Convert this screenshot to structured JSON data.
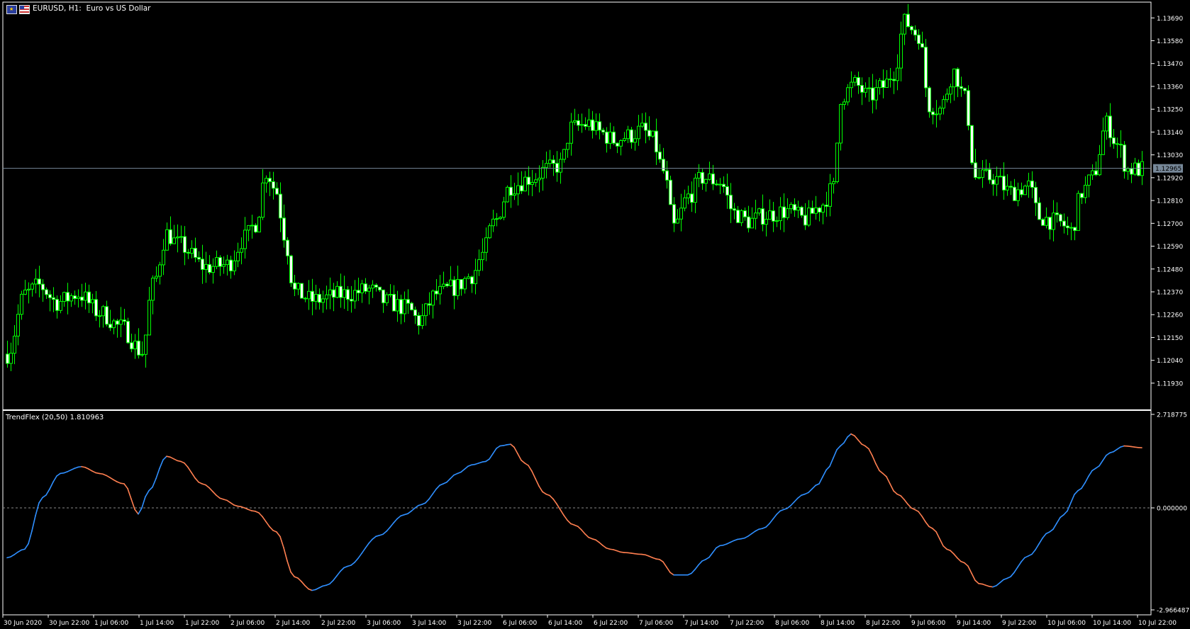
{
  "window": {
    "symbol_title": "EURUSD, H1:  Euro vs US Dollar",
    "current_price_label": "1.12965"
  },
  "price_axis": {
    "labels": [
      "1.13690",
      "1.13580",
      "1.13470",
      "1.13360",
      "1.13250",
      "1.13140",
      "1.13030",
      "1.12920",
      "1.12810",
      "1.12700",
      "1.12590",
      "1.12480",
      "1.12370",
      "1.12260",
      "1.12150",
      "1.12040",
      "1.11930"
    ],
    "max": 1.13708,
    "min": 1.11858
  },
  "indicator": {
    "title": "TrendFlex (20,50) 1.810963",
    "axis_labels": [
      "2.718775",
      "0.000000",
      "-2.966487"
    ],
    "max": 2.718775,
    "min": -2.966487
  },
  "time_axis": {
    "labels": [
      "30 Jun 2020",
      "30 Jun 22:00",
      "1 Jul 06:00",
      "1 Jul 14:00",
      "1 Jul 22:00",
      "2 Jul 06:00",
      "2 Jul 14:00",
      "2 Jul 22:00",
      "3 Jul 06:00",
      "3 Jul 14:00",
      "3 Jul 22:00",
      "6 Jul 06:00",
      "6 Jul 14:00",
      "6 Jul 22:00",
      "7 Jul 06:00",
      "7 Jul 14:00",
      "7 Jul 22:00",
      "8 Jul 06:00",
      "8 Jul 14:00",
      "8 Jul 22:00",
      "9 Jul 06:00",
      "9 Jul 14:00",
      "9 Jul 22:00",
      "10 Jul 06:00",
      "10 Jul 14:00",
      "10 Jul 22:00"
    ]
  },
  "colors": {
    "background": "#000000",
    "candle": "#00ff00",
    "bull_body": "#000000",
    "bear_body": "#ffffff",
    "bid_line": "#778899",
    "trend_up": "#2f8fff",
    "trend_down": "#ff7f50",
    "axis": "#ffffff"
  },
  "price_keypoints": [
    [
      0,
      1.1207
    ],
    [
      5,
      1.1236
    ],
    [
      9,
      1.124
    ],
    [
      14,
      1.1232
    ],
    [
      20,
      1.1236
    ],
    [
      26,
      1.1227
    ],
    [
      32,
      1.122
    ],
    [
      38,
      1.1208
    ],
    [
      41,
      1.124
    ],
    [
      45,
      1.1265
    ],
    [
      48,
      1.126
    ],
    [
      56,
      1.1249
    ],
    [
      62,
      1.125
    ],
    [
      67,
      1.1263
    ],
    [
      70,
      1.127
    ],
    [
      73,
      1.1295
    ],
    [
      76,
      1.1285
    ],
    [
      78,
      1.1265
    ],
    [
      81,
      1.1237
    ],
    [
      86,
      1.1233
    ],
    [
      96,
      1.1236
    ],
    [
      102,
      1.1238
    ],
    [
      107,
      1.1232
    ],
    [
      113,
      1.1229
    ],
    [
      116,
      1.1223
    ],
    [
      121,
      1.1236
    ],
    [
      126,
      1.1239
    ],
    [
      131,
      1.1245
    ],
    [
      134,
      1.1255
    ],
    [
      137,
      1.127
    ],
    [
      142,
      1.1288
    ],
    [
      148,
      1.1292
    ],
    [
      152,
      1.1296
    ],
    [
      156,
      1.1298
    ],
    [
      159,
      1.1316
    ],
    [
      164,
      1.1318
    ],
    [
      167,
      1.1314
    ],
    [
      171,
      1.131
    ],
    [
      175,
      1.1312
    ],
    [
      179,
      1.1315
    ],
    [
      182,
      1.131
    ],
    [
      185,
      1.1295
    ],
    [
      188,
      1.1268
    ],
    [
      192,
      1.1283
    ],
    [
      196,
      1.1292
    ],
    [
      201,
      1.129
    ],
    [
      205,
      1.1275
    ],
    [
      209,
      1.1271
    ],
    [
      214,
      1.1274
    ],
    [
      220,
      1.1276
    ],
    [
      225,
      1.1272
    ],
    [
      229,
      1.1278
    ],
    [
      233,
      1.1287
    ],
    [
      235,
      1.1331
    ],
    [
      239,
      1.1337
    ],
    [
      243,
      1.1331
    ],
    [
      247,
      1.1336
    ],
    [
      250,
      1.1343
    ],
    [
      253,
      1.1367
    ],
    [
      257,
      1.1361
    ],
    [
      260,
      1.1327
    ],
    [
      263,
      1.1325
    ],
    [
      267,
      1.1343
    ],
    [
      270,
      1.133
    ],
    [
      273,
      1.1292
    ],
    [
      278,
      1.1292
    ],
    [
      283,
      1.1285
    ],
    [
      288,
      1.1288
    ],
    [
      291,
      1.1273
    ],
    [
      297,
      1.127
    ],
    [
      300,
      1.1266
    ],
    [
      303,
      1.1285
    ],
    [
      306,
      1.1292
    ],
    [
      310,
      1.1318
    ],
    [
      313,
      1.1308
    ],
    [
      316,
      1.1296
    ],
    [
      320,
      1.1296
    ]
  ],
  "trend_keypoints": [
    [
      0,
      -1.45
    ],
    [
      5,
      -1.2
    ],
    [
      10,
      0.3
    ],
    [
      15,
      1.0
    ],
    [
      21,
      1.2
    ],
    [
      26,
      1.0
    ],
    [
      33,
      0.7
    ],
    [
      37,
      -0.18
    ],
    [
      40,
      0.5
    ],
    [
      45,
      1.5
    ],
    [
      49,
      1.35
    ],
    [
      55,
      0.7
    ],
    [
      61,
      0.25
    ],
    [
      65,
      0.05
    ],
    [
      70,
      -0.1
    ],
    [
      76,
      -0.7
    ],
    [
      81,
      -2.0
    ],
    [
      86,
      -2.4
    ],
    [
      90,
      -2.25
    ],
    [
      96,
      -1.7
    ],
    [
      105,
      -0.8
    ],
    [
      112,
      -0.2
    ],
    [
      117,
      0.1
    ],
    [
      123,
      0.7
    ],
    [
      127,
      1.0
    ],
    [
      131,
      1.25
    ],
    [
      135,
      1.35
    ],
    [
      139,
      1.8
    ],
    [
      142,
      1.85
    ],
    [
      146,
      1.3
    ],
    [
      152,
      0.4
    ],
    [
      160,
      -0.5
    ],
    [
      165,
      -0.9
    ],
    [
      170,
      -1.2
    ],
    [
      174,
      -1.3
    ],
    [
      179,
      -1.35
    ],
    [
      184,
      -1.5
    ],
    [
      188,
      -1.95
    ],
    [
      192,
      -1.95
    ],
    [
      197,
      -1.5
    ],
    [
      201,
      -1.1
    ],
    [
      207,
      -0.9
    ],
    [
      213,
      -0.6
    ],
    [
      219,
      -0.05
    ],
    [
      225,
      0.4
    ],
    [
      229,
      0.7
    ],
    [
      231,
      1.1
    ],
    [
      235,
      1.8
    ],
    [
      238,
      2.15
    ],
    [
      242,
      1.8
    ],
    [
      247,
      1.0
    ],
    [
      251,
      0.4
    ],
    [
      256,
      -0.05
    ],
    [
      261,
      -0.6
    ],
    [
      265,
      -1.2
    ],
    [
      270,
      -1.6
    ],
    [
      274,
      -2.2
    ],
    [
      278,
      -2.3
    ],
    [
      282,
      -2.05
    ],
    [
      288,
      -1.4
    ],
    [
      294,
      -0.7
    ],
    [
      298,
      -0.2
    ],
    [
      302,
      0.5
    ],
    [
      307,
      1.15
    ],
    [
      311,
      1.6
    ],
    [
      315,
      1.8
    ],
    [
      320,
      1.75
    ]
  ]
}
